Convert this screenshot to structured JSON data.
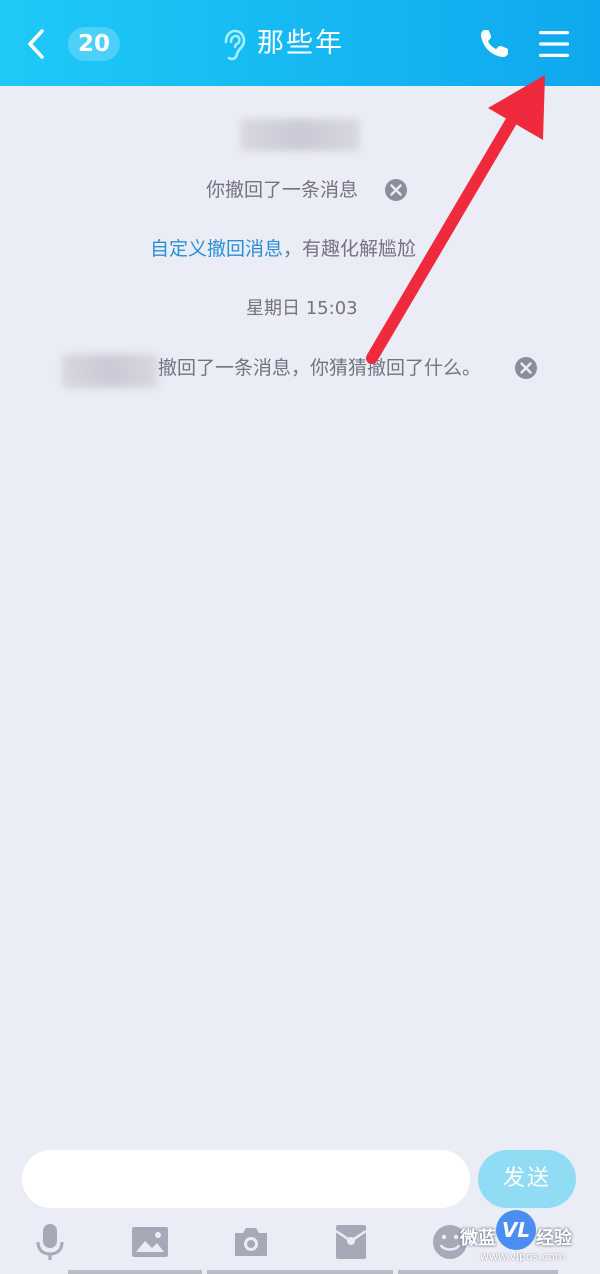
{
  "header": {
    "back_count": "20",
    "title": "那些年",
    "icons": [
      "chevron-left-icon",
      "ear-icon",
      "phone-icon",
      "menu-icon"
    ]
  },
  "messages": {
    "recall_self": "你撤回了一条消息",
    "custom_link": "自定义撤回消息",
    "custom_rest": "，有趣化解尴尬",
    "timestamp": "星期日 15:03",
    "recall_other": "撤回了一条消息，你猜猜撤回了什么。"
  },
  "input": {
    "placeholder": "",
    "send_label": "发送"
  },
  "toolbar": {
    "icons": [
      "microphone-icon",
      "image-icon",
      "camera-icon",
      "red-packet-icon",
      "emoji-icon"
    ]
  },
  "watermark": {
    "left_text": "微蓝",
    "logo_text": "VL",
    "right_text": "经验",
    "url": "www.vlpos.com"
  },
  "colors": {
    "header_start": "#1ec9f7",
    "header_end": "#0fa8ee",
    "background": "#ebedf6",
    "link": "#2d8dd6",
    "send_button": "#8fdcf4",
    "arrow": "#ee2a3c"
  }
}
